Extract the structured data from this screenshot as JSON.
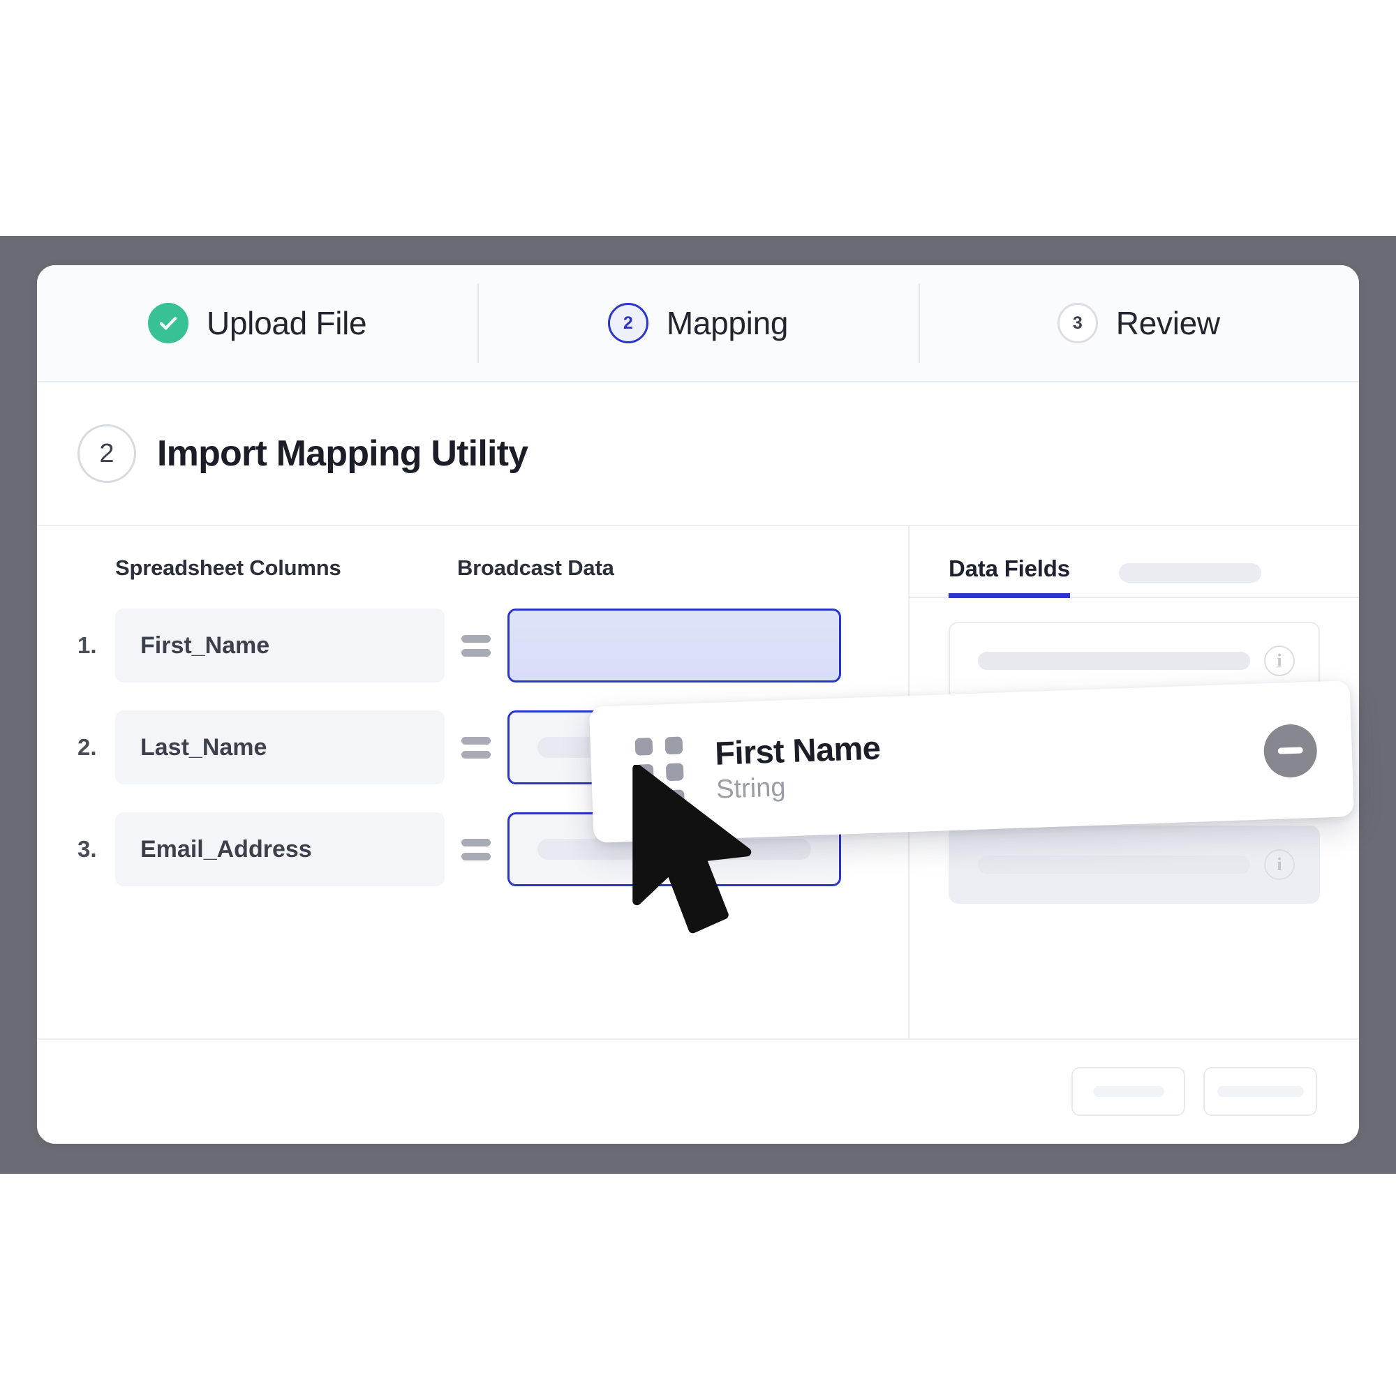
{
  "window": {
    "bezel_color": "#6b6c73",
    "surface_color": "#ffffff"
  },
  "stepper": {
    "steps": [
      {
        "badge": "✓",
        "label": "Upload File",
        "state": "completed",
        "icon": "check-icon",
        "color": "#38c194"
      },
      {
        "badge": "2",
        "label": "Mapping",
        "state": "active",
        "icon": "step-number",
        "color": "#2b35c9"
      },
      {
        "badge": "3",
        "label": "Review",
        "state": "idle",
        "icon": "step-number",
        "color": "#dcdee4"
      }
    ]
  },
  "title": {
    "badge": "2",
    "text": "Import Mapping Utility"
  },
  "mapping": {
    "headers": {
      "source": "Spreadsheet Columns",
      "target": "Broadcast Data"
    },
    "equals_icon": "equals-icon",
    "rows": [
      {
        "number": "1.",
        "source": "First_Name",
        "target_state": "drop-active-filled",
        "target_value": ""
      },
      {
        "number": "2.",
        "source": "Last_Name",
        "target_state": "drop-active",
        "target_value": ""
      },
      {
        "number": "3.",
        "source": "Email_Address",
        "target_state": "drop-active",
        "target_value": ""
      }
    ]
  },
  "fields_panel": {
    "tabs": [
      {
        "label": "Data Fields",
        "active": true
      },
      {
        "label": "",
        "active": false,
        "placeholder": true
      }
    ],
    "rows": [
      {
        "label": "",
        "shaded": false,
        "info_icon": "info-icon"
      },
      {
        "label": "",
        "shaded": false,
        "info_icon": "info-icon"
      },
      {
        "label": "",
        "shaded": true,
        "info_icon": "info-icon"
      }
    ]
  },
  "drag_card": {
    "handle_icon": "drag-handle-icon",
    "title": "First Name",
    "subtype": "String",
    "remove_icon": "minus-circle-icon",
    "remove_color": "#86878f"
  },
  "cursor": {
    "icon": "mouse-pointer-icon",
    "color": "#111111"
  },
  "footer": {
    "buttons": [
      {
        "label": "",
        "placeholder": true
      },
      {
        "label": "",
        "placeholder": true
      }
    ]
  }
}
